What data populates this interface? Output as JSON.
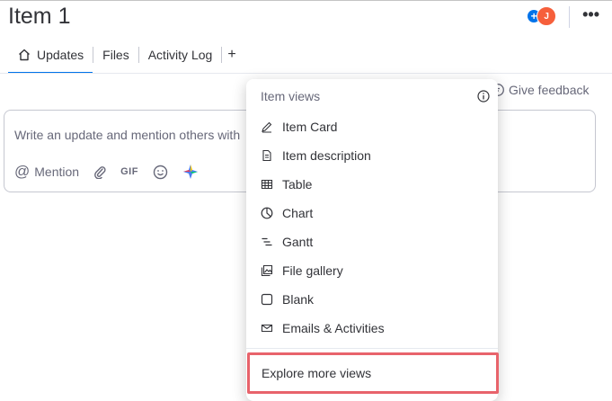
{
  "header": {
    "title": "Item 1",
    "avatar_initial": "J",
    "add_subscriber_symbol": "+",
    "more_symbol": "•••"
  },
  "tabs": [
    {
      "label": "Updates",
      "active": true,
      "icon": "home-icon"
    },
    {
      "label": "Files",
      "active": false
    },
    {
      "label": "Activity Log",
      "active": false
    }
  ],
  "tab_add_symbol": "+",
  "feedback_label": "Give feedback",
  "update_box": {
    "placeholder": "Write an update and mention others with",
    "mention_label": "Mention",
    "gif_label": "GIF"
  },
  "menu": {
    "header": "Item views",
    "items": [
      {
        "label": "Item Card",
        "icon": "item-card-icon"
      },
      {
        "label": "Item description",
        "icon": "document-icon"
      },
      {
        "label": "Table",
        "icon": "table-icon"
      },
      {
        "label": "Chart",
        "icon": "chart-icon"
      },
      {
        "label": "Gantt",
        "icon": "gantt-icon"
      },
      {
        "label": "File gallery",
        "icon": "gallery-icon"
      },
      {
        "label": "Blank",
        "icon": "blank-icon"
      },
      {
        "label": "Emails & Activities",
        "icon": "email-icon"
      }
    ],
    "explore_label": "Explore more views"
  },
  "colors": {
    "accent": "#0073ea",
    "avatar": "#f65f3b",
    "highlight": "#e8636b",
    "text": "#323338",
    "muted": "#676879"
  }
}
